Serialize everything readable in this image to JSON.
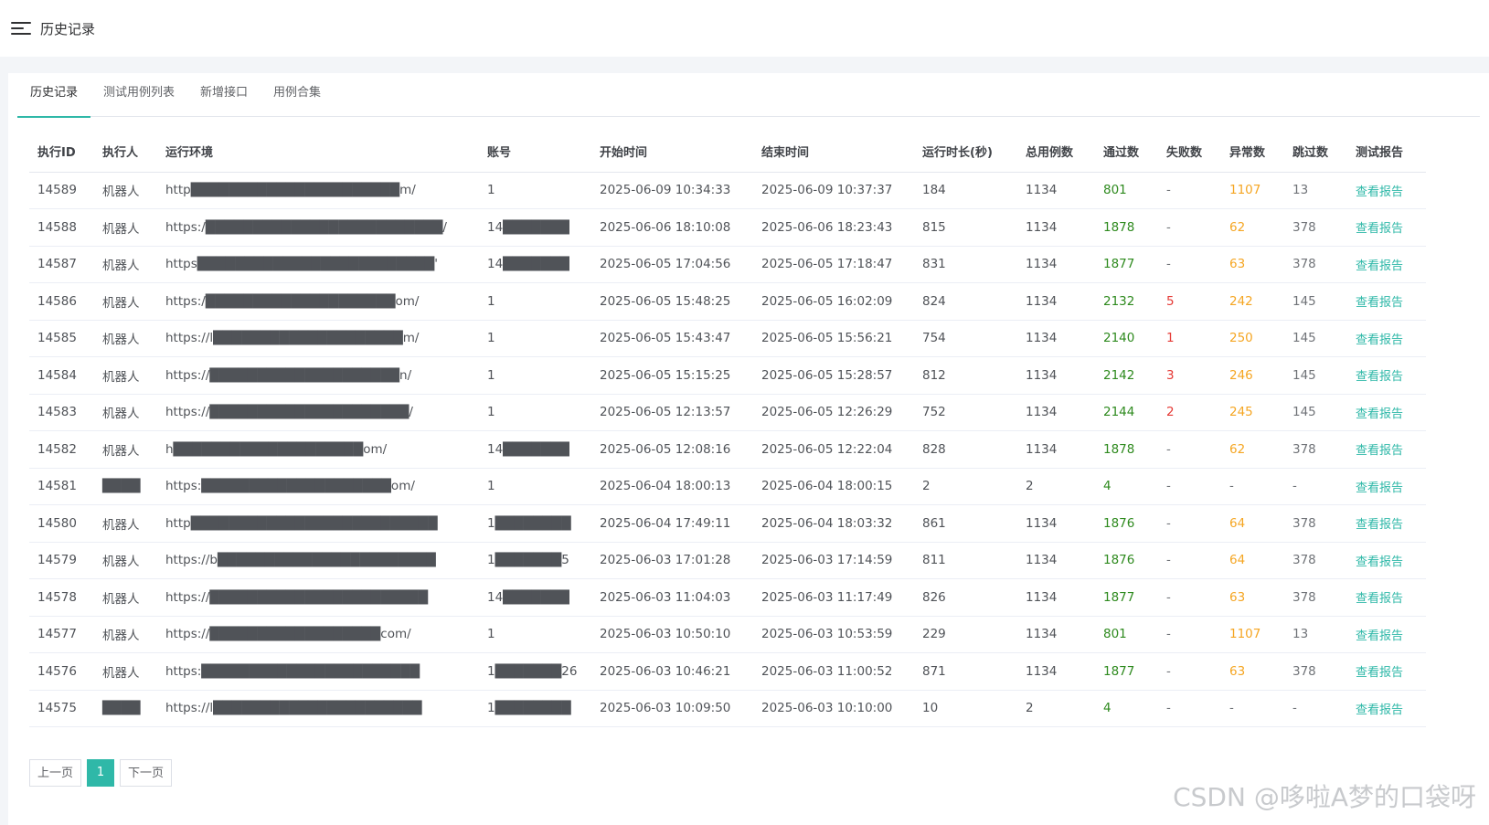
{
  "header": {
    "title": "历史记录"
  },
  "tabs": [
    {
      "label": "历史记录",
      "active": true
    },
    {
      "label": "测试用例列表",
      "active": false
    },
    {
      "label": "新增接口",
      "active": false
    },
    {
      "label": "用例合集",
      "active": false
    }
  ],
  "table": {
    "columns": [
      "执行ID",
      "执行人",
      "运行环境",
      "账号",
      "开始时间",
      "结束时间",
      "运行时长(秒)",
      "总用例数",
      "通过数",
      "失败数",
      "异常数",
      "跳过数",
      "测试报告"
    ],
    "rows": [
      {
        "id": "14589",
        "executor": "机器人",
        "env": "http██████████████████████m/",
        "account": "1",
        "start": "2025-06-09 10:34:33",
        "end": "2025-06-09 10:37:37",
        "duration": "184",
        "total": "1134",
        "passed": "801",
        "failed": "-",
        "error": "1107",
        "skipped": "13",
        "report": "查看报告"
      },
      {
        "id": "14588",
        "executor": "机器人",
        "env": "https:/█████████████████████████/",
        "account": "14███████",
        "start": "2025-06-06 18:10:08",
        "end": "2025-06-06 18:23:43",
        "duration": "815",
        "total": "1134",
        "passed": "1878",
        "failed": "-",
        "error": "62",
        "skipped": "378",
        "report": "查看报告"
      },
      {
        "id": "14587",
        "executor": "机器人",
        "env": "https█████████████████████████'",
        "account": "14███████",
        "start": "2025-06-05 17:04:56",
        "end": "2025-06-05 17:18:47",
        "duration": "831",
        "total": "1134",
        "passed": "1877",
        "failed": "-",
        "error": "63",
        "skipped": "378",
        "report": "查看报告"
      },
      {
        "id": "14586",
        "executor": "机器人",
        "env": "https:/████████████████████om/",
        "account": "1",
        "start": "2025-06-05 15:48:25",
        "end": "2025-06-05 16:02:09",
        "duration": "824",
        "total": "1134",
        "passed": "2132",
        "failed": "5",
        "error": "242",
        "skipped": "145",
        "report": "查看报告"
      },
      {
        "id": "14585",
        "executor": "机器人",
        "env": "https://l████████████████████m/",
        "account": "1",
        "start": "2025-06-05 15:43:47",
        "end": "2025-06-05 15:56:21",
        "duration": "754",
        "total": "1134",
        "passed": "2140",
        "failed": "1",
        "error": "250",
        "skipped": "145",
        "report": "查看报告"
      },
      {
        "id": "14584",
        "executor": "机器人",
        "env": "https://████████████████████n/",
        "account": "1",
        "start": "2025-06-05 15:15:25",
        "end": "2025-06-05 15:28:57",
        "duration": "812",
        "total": "1134",
        "passed": "2142",
        "failed": "3",
        "error": "246",
        "skipped": "145",
        "report": "查看报告"
      },
      {
        "id": "14583",
        "executor": "机器人",
        "env": "https://█████████████████████/",
        "account": "1",
        "start": "2025-06-05 12:13:57",
        "end": "2025-06-05 12:26:29",
        "duration": "752",
        "total": "1134",
        "passed": "2144",
        "failed": "2",
        "error": "245",
        "skipped": "145",
        "report": "查看报告"
      },
      {
        "id": "14582",
        "executor": "机器人",
        "env": "h████████████████████om/",
        "account": "14███████",
        "start": "2025-06-05 12:08:16",
        "end": "2025-06-05 12:22:04",
        "duration": "828",
        "total": "1134",
        "passed": "1878",
        "failed": "-",
        "error": "62",
        "skipped": "378",
        "report": "查看报告"
      },
      {
        "id": "14581",
        "executor": "████",
        "env": "https:████████████████████om/",
        "account": "1",
        "start": "2025-06-04 18:00:13",
        "end": "2025-06-04 18:00:15",
        "duration": "2",
        "total": "2",
        "passed": "4",
        "failed": "-",
        "error": "-",
        "skipped": "-",
        "report": "查看报告"
      },
      {
        "id": "14580",
        "executor": "机器人",
        "env": "http██████████████████████████",
        "account": "1████████",
        "start": "2025-06-04 17:49:11",
        "end": "2025-06-04 18:03:32",
        "duration": "861",
        "total": "1134",
        "passed": "1876",
        "failed": "-",
        "error": "64",
        "skipped": "378",
        "report": "查看报告"
      },
      {
        "id": "14579",
        "executor": "机器人",
        "env": "https://b███████████████████████",
        "account": "1███████5",
        "start": "2025-06-03 17:01:28",
        "end": "2025-06-03 17:14:59",
        "duration": "811",
        "total": "1134",
        "passed": "1876",
        "failed": "-",
        "error": "64",
        "skipped": "378",
        "report": "查看报告"
      },
      {
        "id": "14578",
        "executor": "机器人",
        "env": "https://███████████████████████",
        "account": "14███████",
        "start": "2025-06-03 11:04:03",
        "end": "2025-06-03 11:17:49",
        "duration": "826",
        "total": "1134",
        "passed": "1877",
        "failed": "-",
        "error": "63",
        "skipped": "378",
        "report": "查看报告"
      },
      {
        "id": "14577",
        "executor": "机器人",
        "env": "https://██████████████████com/",
        "account": "1",
        "start": "2025-06-03 10:50:10",
        "end": "2025-06-03 10:53:59",
        "duration": "229",
        "total": "1134",
        "passed": "801",
        "failed": "-",
        "error": "1107",
        "skipped": "13",
        "report": "查看报告"
      },
      {
        "id": "14576",
        "executor": "机器人",
        "env": "https:███████████████████████",
        "account": "1███████26",
        "start": "2025-06-03 10:46:21",
        "end": "2025-06-03 11:00:52",
        "duration": "871",
        "total": "1134",
        "passed": "1877",
        "failed": "-",
        "error": "63",
        "skipped": "378",
        "report": "查看报告"
      },
      {
        "id": "14575",
        "executor": "████",
        "env": "https://l██████████████████████",
        "account": "1████████",
        "start": "2025-06-03 10:09:50",
        "end": "2025-06-03 10:10:00",
        "duration": "10",
        "total": "2",
        "passed": "4",
        "failed": "-",
        "error": "-",
        "skipped": "-",
        "report": "查看报告"
      }
    ]
  },
  "pagination": {
    "prev": "上一页",
    "current": "1",
    "next": "下一页"
  },
  "watermark": "CSDN @哆啦A梦的口袋呀",
  "colors": {
    "accent": "#2fb8a8",
    "passed": "#2e8a1e",
    "failed": "#e53935",
    "error": "#f5a623"
  }
}
